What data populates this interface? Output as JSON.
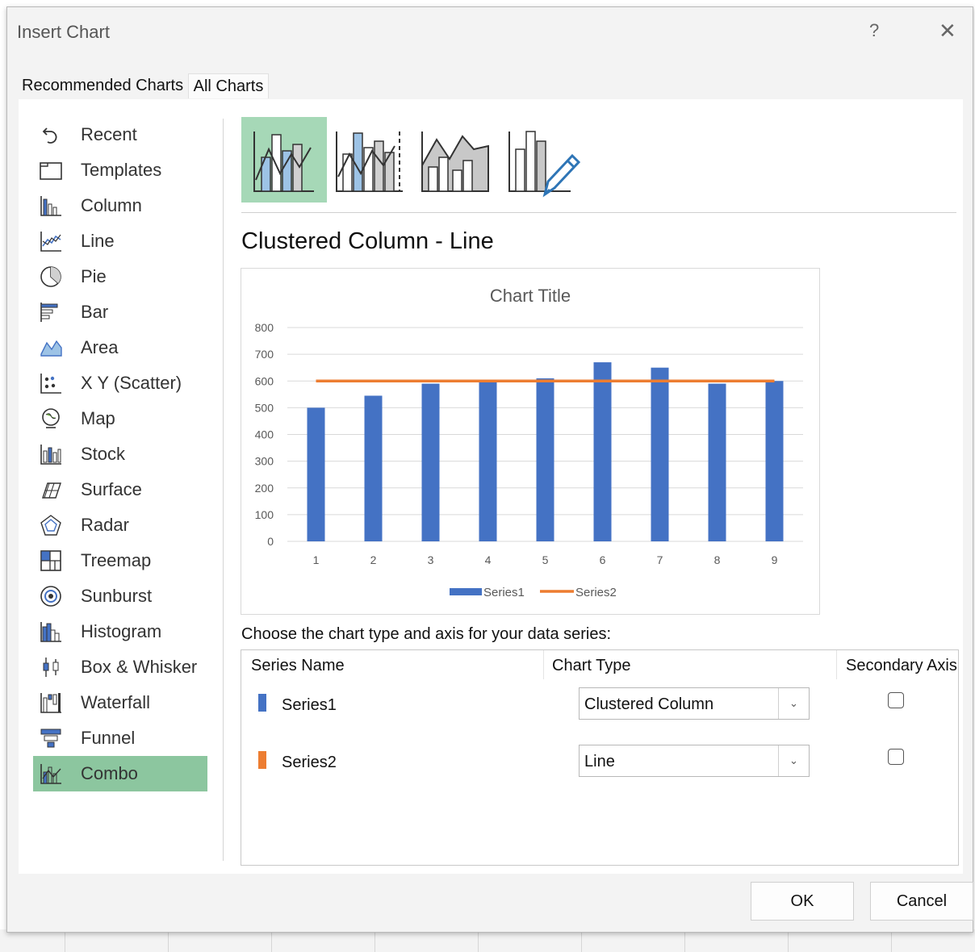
{
  "dialog": {
    "title": "Insert Chart",
    "help_label": "?",
    "close_label": "✕"
  },
  "tabs": [
    {
      "label": "Recommended Charts"
    },
    {
      "label": "All Charts"
    }
  ],
  "chart_types": [
    {
      "label": "Recent",
      "icon": "recent-icon"
    },
    {
      "label": "Templates",
      "icon": "templates-icon"
    },
    {
      "label": "Column",
      "icon": "column-chart-icon"
    },
    {
      "label": "Line",
      "icon": "line-chart-icon"
    },
    {
      "label": "Pie",
      "icon": "pie-chart-icon"
    },
    {
      "label": "Bar",
      "icon": "bar-chart-icon"
    },
    {
      "label": "Area",
      "icon": "area-chart-icon"
    },
    {
      "label": "X Y (Scatter)",
      "icon": "scatter-chart-icon"
    },
    {
      "label": "Map",
      "icon": "map-chart-icon"
    },
    {
      "label": "Stock",
      "icon": "stock-chart-icon"
    },
    {
      "label": "Surface",
      "icon": "surface-chart-icon"
    },
    {
      "label": "Radar",
      "icon": "radar-chart-icon"
    },
    {
      "label": "Treemap",
      "icon": "treemap-chart-icon"
    },
    {
      "label": "Sunburst",
      "icon": "sunburst-chart-icon"
    },
    {
      "label": "Histogram",
      "icon": "histogram-chart-icon"
    },
    {
      "label": "Box & Whisker",
      "icon": "box-whisker-chart-icon"
    },
    {
      "label": "Waterfall",
      "icon": "waterfall-chart-icon"
    },
    {
      "label": "Funnel",
      "icon": "funnel-chart-icon"
    },
    {
      "label": "Combo",
      "icon": "combo-chart-icon",
      "selected": true
    }
  ],
  "subtypes": [
    {
      "icon": "clustered-column-line-icon",
      "selected": true
    },
    {
      "icon": "clustered-column-line-secondary-axis-icon"
    },
    {
      "icon": "stacked-area-clustered-column-icon"
    },
    {
      "icon": "custom-combination-icon"
    }
  ],
  "subtype_title": "Clustered Column - Line",
  "chart_data": {
    "type": "bar",
    "title": "Chart Title",
    "categories": [
      "1",
      "2",
      "3",
      "4",
      "5",
      "6",
      "7",
      "8",
      "9"
    ],
    "ylim": [
      0,
      800
    ],
    "yticks": [
      "0",
      "100",
      "200",
      "300",
      "400",
      "500",
      "600",
      "700",
      "800"
    ],
    "grid": true,
    "legend_position": "bottom",
    "series": [
      {
        "name": "Series1",
        "kind": "column",
        "color": "#4472c4",
        "values": [
          500,
          545,
          590,
          600,
          610,
          670,
          650,
          590,
          600
        ]
      },
      {
        "name": "Series2",
        "kind": "line",
        "color": "#ed7d31",
        "values": [
          600,
          600,
          600,
          600,
          600,
          600,
          600,
          600,
          600
        ]
      }
    ]
  },
  "series_config": {
    "instruction": "Choose the chart type and axis for your data series:",
    "headers": {
      "name": "Series Name",
      "type": "Chart Type",
      "axis": "Secondary Axis"
    },
    "rows": [
      {
        "name": "Series1",
        "color": "#4472c4",
        "chart_type": "Clustered Column",
        "secondary_axis": false
      },
      {
        "name": "Series2",
        "color": "#ed7d31",
        "chart_type": "Line",
        "secondary_axis": false
      }
    ]
  },
  "buttons": {
    "ok": "OK",
    "cancel": "Cancel"
  }
}
